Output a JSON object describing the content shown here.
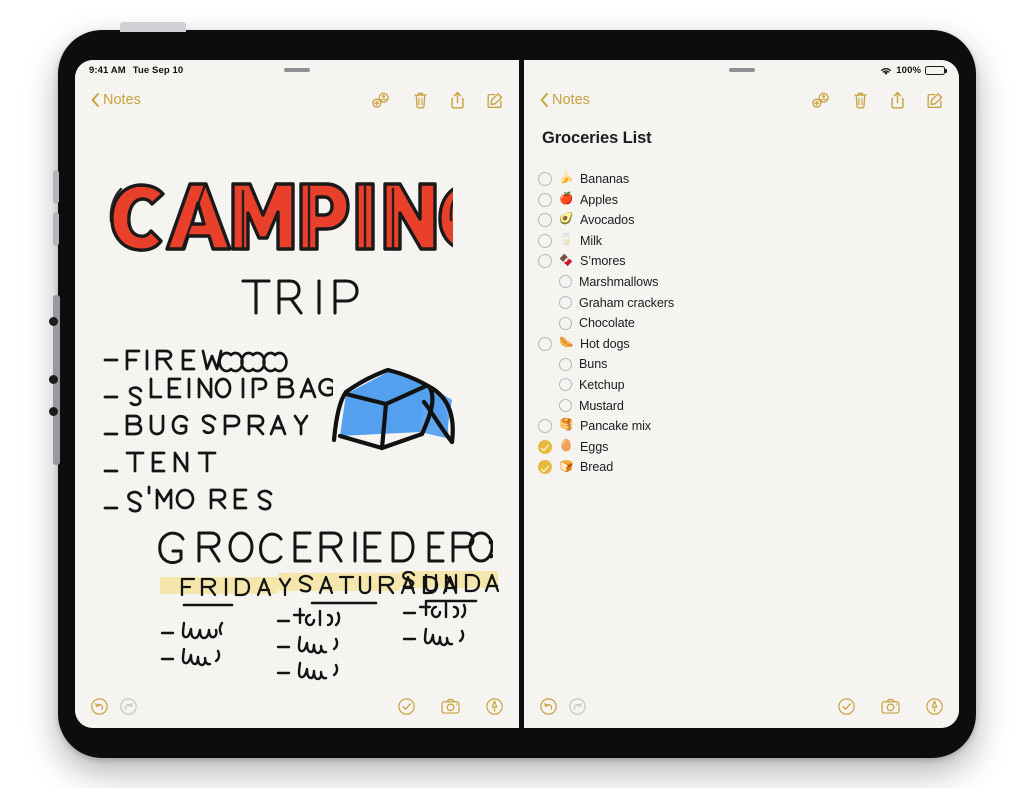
{
  "device": {
    "name": "ipad-pro"
  },
  "status_bar": {
    "time": "9:41 AM",
    "date": "Tue Sep 10",
    "battery_percent": "100%",
    "wifi_icon": "wifi-icon",
    "battery_icon": "battery-icon"
  },
  "left_pane": {
    "back_label": "Notes",
    "toolbar_icons": [
      {
        "name": "collaborate-icon",
        "label": "Collaborate"
      },
      {
        "name": "trash-icon",
        "label": "Delete"
      },
      {
        "name": "share-icon",
        "label": "Share"
      },
      {
        "name": "compose-icon",
        "label": "New Note"
      }
    ],
    "handwritten": {
      "title_line1": "CAMPING",
      "title_line2": "TRIP",
      "checklist": [
        "FIREWOOD",
        "SLEEPING BAG",
        "BUG SPRAY",
        "TENT",
        "S'MORES"
      ],
      "drawing": "tent-drawing",
      "groceries_heading": "GROCERIES FOR :",
      "days": [
        {
          "name": "FRIDAY",
          "meals": [
            "lunch",
            "dinner"
          ]
        },
        {
          "name": "SATURDAY",
          "meals": [
            "b'fast",
            "lunch",
            "dinner"
          ]
        },
        {
          "name": "SUNDAY",
          "meals": [
            "b'fast",
            "lunch"
          ]
        }
      ]
    },
    "bottom_icons": [
      {
        "name": "undo-icon",
        "state": "enabled"
      },
      {
        "name": "redo-icon",
        "state": "disabled"
      },
      {
        "name": "checklist-icon",
        "state": "enabled"
      },
      {
        "name": "camera-icon",
        "state": "enabled"
      },
      {
        "name": "markup-icon",
        "state": "enabled"
      }
    ]
  },
  "right_pane": {
    "back_label": "Notes",
    "toolbar_icons": [
      {
        "name": "collaborate-icon",
        "label": "Collaborate"
      },
      {
        "name": "trash-icon",
        "label": "Delete"
      },
      {
        "name": "share-icon",
        "label": "Share"
      },
      {
        "name": "compose-icon",
        "label": "New Note"
      }
    ],
    "note_title": "Groceries List",
    "items": [
      {
        "label": "Bananas",
        "emoji": "🍌",
        "checked": false,
        "sub": false
      },
      {
        "label": "Apples",
        "emoji": "🍎",
        "checked": false,
        "sub": false
      },
      {
        "label": "Avocados",
        "emoji": "🥑",
        "checked": false,
        "sub": false
      },
      {
        "label": "Milk",
        "emoji": "🥛",
        "checked": false,
        "sub": false
      },
      {
        "label": "S’mores",
        "emoji": "🍫",
        "checked": false,
        "sub": false
      },
      {
        "label": "Marshmallows",
        "emoji": "",
        "checked": false,
        "sub": true
      },
      {
        "label": "Graham crackers",
        "emoji": "",
        "checked": false,
        "sub": true
      },
      {
        "label": "Chocolate",
        "emoji": "",
        "checked": false,
        "sub": true
      },
      {
        "label": "Hot dogs",
        "emoji": "🌭",
        "checked": false,
        "sub": false
      },
      {
        "label": "Buns",
        "emoji": "",
        "checked": false,
        "sub": true
      },
      {
        "label": "Ketchup",
        "emoji": "",
        "checked": false,
        "sub": true
      },
      {
        "label": "Mustard",
        "emoji": "",
        "checked": false,
        "sub": true
      },
      {
        "label": "Pancake mix",
        "emoji": "🥞",
        "checked": false,
        "sub": false
      },
      {
        "label": "Eggs",
        "emoji": "🥚",
        "checked": true,
        "sub": false
      },
      {
        "label": "Bread",
        "emoji": "🍞",
        "checked": true,
        "sub": false
      }
    ],
    "bottom_icons": [
      {
        "name": "undo-icon",
        "state": "enabled"
      },
      {
        "name": "redo-icon",
        "state": "disabled"
      },
      {
        "name": "checklist-icon",
        "state": "enabled"
      },
      {
        "name": "camera-icon",
        "state": "enabled"
      },
      {
        "name": "markup-icon",
        "state": "enabled"
      }
    ]
  },
  "colors": {
    "accent_gold": "#c8a23c",
    "checked_gold": "#e8b93f",
    "title_red": "#e8402a",
    "tent_blue": "#54a0ee",
    "highlight_yellow": "#f4e6a8",
    "paper": "#f7f6f3",
    "ink": "#1c1c1e"
  }
}
